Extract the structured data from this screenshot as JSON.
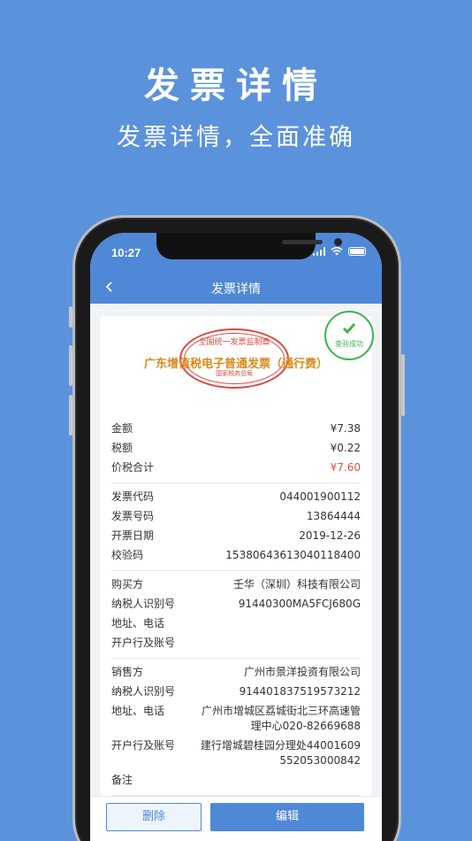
{
  "promo": {
    "title": "发票详情",
    "subtitle": "发票详情，全面准确"
  },
  "status_bar": {
    "time": "10:27"
  },
  "nav": {
    "title": "发票详情",
    "back_icon": "chevron-left-icon"
  },
  "invoice": {
    "type": "广东增值税电子普通发票（通行费）",
    "stamp_top": "全国统一发票监制章",
    "stamp_bottom": "国家税务总局",
    "verified_label": "查验成功",
    "amounts": [
      {
        "label": "金额",
        "value": "¥7.38"
      },
      {
        "label": "税额",
        "value": "¥0.22"
      },
      {
        "label": "价税合计",
        "value": "¥7.60"
      }
    ],
    "codes": [
      {
        "label": "发票代码",
        "value": "044001900112"
      },
      {
        "label": "发票号码",
        "value": "13864444"
      },
      {
        "label": "开票日期",
        "value": "2019-12-26"
      },
      {
        "label": "校验码",
        "value": "15380643613040118400"
      }
    ],
    "buyer": [
      {
        "label": "购买方",
        "value": "壬华（深圳）科技有限公司"
      },
      {
        "label": "纳税人识别号",
        "value": "91440300MA5FCJ680G"
      },
      {
        "label": "地址、电话",
        "value": ""
      },
      {
        "label": "开户行及账号",
        "value": ""
      }
    ],
    "seller": [
      {
        "label": "销售方",
        "value": "广州市景洋投资有限公司"
      },
      {
        "label": "纳税人识别号",
        "value": "914401837519573212"
      },
      {
        "label": "地址、电话",
        "value": "广州市增城区荔城街北三环高速管理中心020-82669688"
      },
      {
        "label": "开户行及账号",
        "value": "建行增城碧桂园分理处44001609552053000842"
      },
      {
        "label": "备注",
        "value": ""
      }
    ]
  },
  "footer": {
    "delete_label": "删除",
    "edit_label": "编辑"
  },
  "colors": {
    "background": "#5b92dc",
    "header": "#4f88d6",
    "accent_red": "#e0524a",
    "verified_green": "#3fb34f",
    "invoice_type": "#d98a1d"
  }
}
